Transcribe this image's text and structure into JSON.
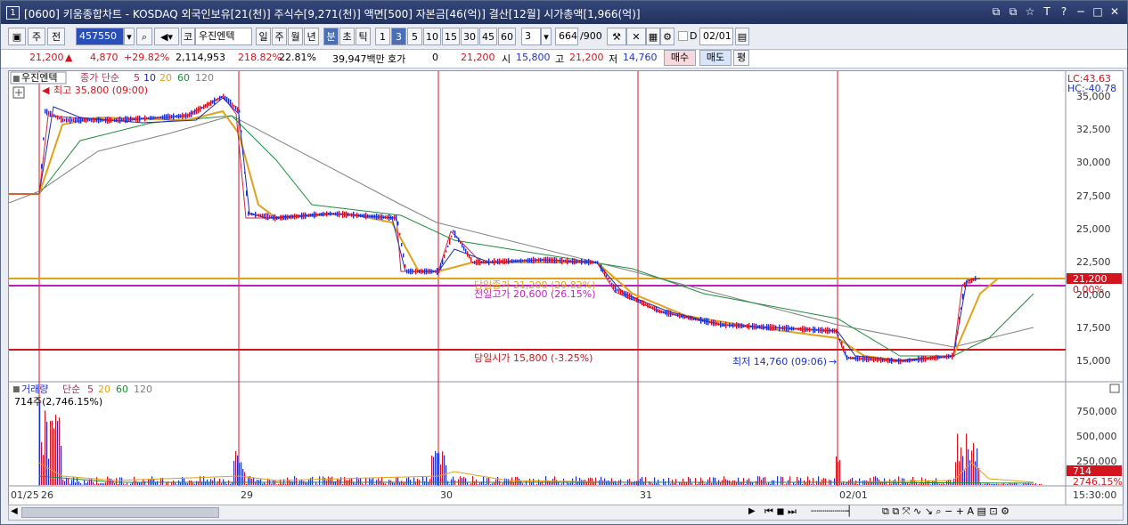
{
  "window": {
    "number": "1",
    "title": "[0600] 키움종합차트 - KOSDAQ 외국인보유[21(천)] 주식수[9,271(천)] 액면[500] 자본금[46(억)] 결산[12월] 시가총액[1,966(억)]",
    "buttons": [
      "⧉",
      "⧉",
      "☆",
      "T",
      "?",
      "─",
      "□",
      "✕"
    ]
  },
  "toolbar": {
    "period_type": "주",
    "period2": "전",
    "code": "457550",
    "market": "코",
    "stock_name": "우진엔텍",
    "periods": [
      "일",
      "주",
      "월",
      "년",
      "분",
      "초",
      "틱"
    ],
    "selected_period": "분",
    "intervals": [
      "1",
      "3",
      "5",
      "10",
      "15",
      "30",
      "45",
      "60"
    ],
    "selected_interval": "3",
    "interval_value": "3",
    "count_value": "664",
    "count_total": "/900",
    "date_checkbox": "D",
    "date_value": "02/01"
  },
  "quote": {
    "price": "21,200",
    "change": "4,870",
    "change_pct": "+29.82%",
    "volume": "2,114,953",
    "vol_ratio": "218.82%",
    "turnover": "22.81%",
    "amount": "39,947백만",
    "hoga_label": "호가",
    "hoga_value": "0",
    "hoga_price": "21,200",
    "open_label": "시",
    "open": "15,800",
    "high_label": "고",
    "high": "21,200",
    "low_label": "저",
    "low": "14,760",
    "buy": "매수",
    "sell": "매도",
    "avg": "평"
  },
  "price_panel": {
    "stock_label": "우진엔텍",
    "indicator_label": "종가 단순",
    "ma_periods": [
      "5",
      "10",
      "20",
      "60",
      "120"
    ],
    "ma_colors": [
      "#c8234a",
      "#1b2ea6",
      "#e0a21a",
      "#1d8d3a",
      "#808080"
    ],
    "lc": "LC:43.63",
    "hc": "HC:-40.78",
    "high_note": "최고 35,800 (09:00)",
    "low_note": "최저 14,760 (09:06)",
    "close_line_label": "당일종가 21,200 (29.82%)",
    "prev_high_label": "전일고가 20,600 (26.15%)",
    "open_line_label": "당일시가 15,800 (-3.25%)",
    "current_price_tag": "21,200",
    "current_pct_tag": "0.00%",
    "y_axis": [
      "35,000",
      "32,500",
      "30,000",
      "27,500",
      "25,000",
      "22,500",
      "20,000",
      "17,500",
      "15,000"
    ]
  },
  "volume_panel": {
    "label": "거래량",
    "indicator_label": "단순",
    "ma_periods": [
      "5",
      "20",
      "60",
      "120"
    ],
    "current": "714주(2,746.15%)",
    "tag_value": "714",
    "tag_pct": "2746.15%",
    "y_axis": [
      "750,000",
      "500,000",
      "250,000"
    ]
  },
  "x_axis": {
    "labels": [
      "01/25",
      "26",
      "29",
      "30",
      "31",
      "02/01"
    ],
    "time": "15:30:00"
  },
  "colors": {
    "title_bg": "#23325e",
    "up": "#d1141e",
    "down": "#1b32c8",
    "close_line": "#e0a21a",
    "prev_high_line": "#c01fbf",
    "open_line": "#d1141e"
  }
}
